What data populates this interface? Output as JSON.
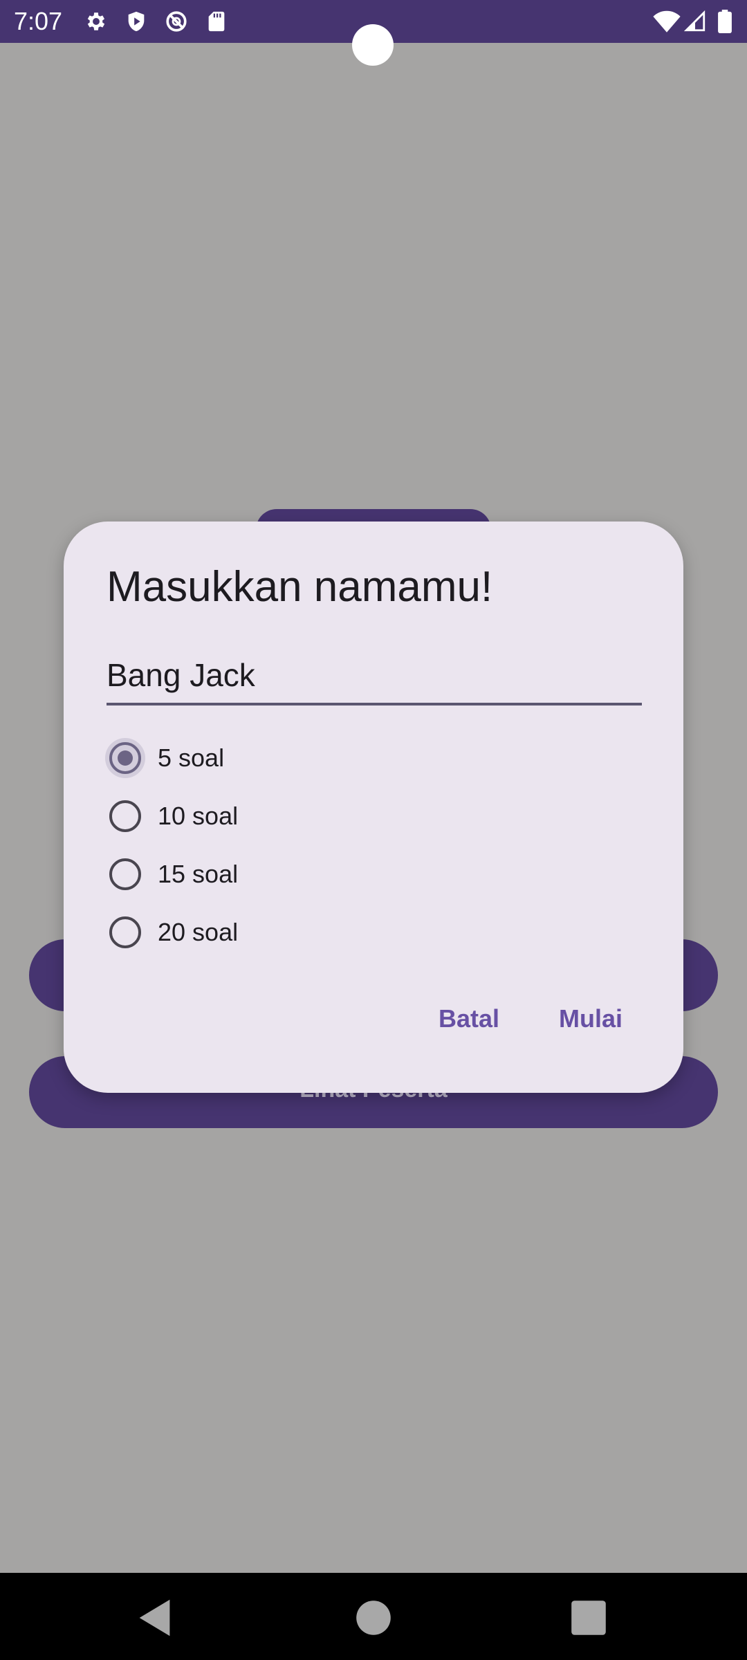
{
  "status_bar": {
    "time": "7:07",
    "left_icons": [
      "gear-icon",
      "shield-play-icon",
      "block-icon",
      "sd-card-icon"
    ],
    "right_icons": [
      "wifi-icon",
      "signal-icon",
      "battery-icon"
    ]
  },
  "background_screen": {
    "buttons": [
      {
        "label": ""
      },
      {
        "label": "Lihat Peserta"
      }
    ]
  },
  "dialog": {
    "title": "Masukkan namamu!",
    "name_input": {
      "value": "Bang Jack",
      "placeholder": ""
    },
    "options": [
      {
        "label": "5 soal",
        "checked": true
      },
      {
        "label": "10 soal",
        "checked": false
      },
      {
        "label": "15 soal",
        "checked": false
      },
      {
        "label": "20 soal",
        "checked": false
      }
    ],
    "actions": {
      "cancel_label": "Batal",
      "start_label": "Mulai"
    }
  },
  "nav_bar": {
    "icons": [
      "back-icon",
      "home-icon",
      "recents-icon"
    ]
  },
  "colors": {
    "primary": "#463470",
    "accent": "#6750a4",
    "dialog_bg": "#ebe5ef",
    "scrim": "#a5a4a3"
  }
}
